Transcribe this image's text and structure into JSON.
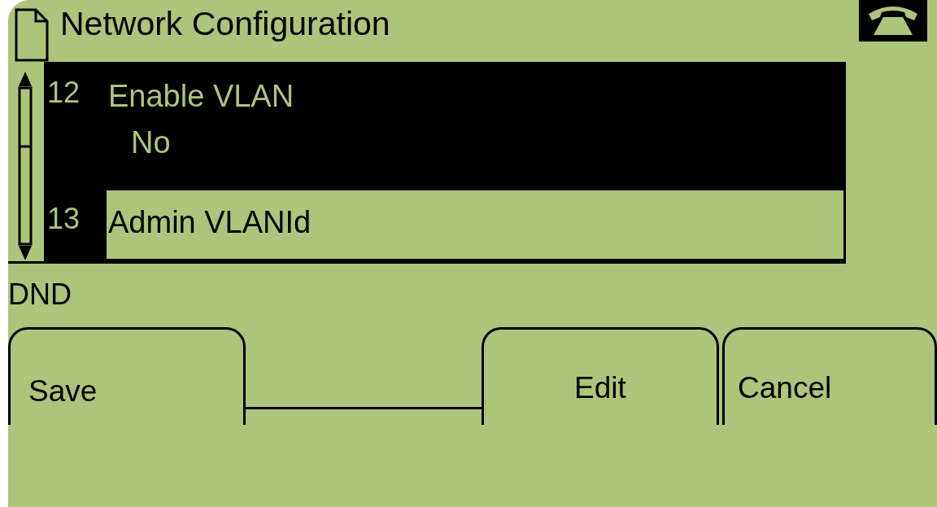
{
  "header": {
    "title": "Network Configuration"
  },
  "items": [
    {
      "number": "12",
      "label": "Enable VLAN",
      "value": "No",
      "selected": true
    },
    {
      "number": "13",
      "label": "Admin VLANId",
      "selected": false
    }
  ],
  "status": "DND",
  "softkeys": [
    {
      "label": "Save",
      "kind": "key"
    },
    {
      "kind": "blank"
    },
    {
      "label": "Edit",
      "kind": "key"
    },
    {
      "label": "Cancel",
      "kind": "key"
    }
  ]
}
